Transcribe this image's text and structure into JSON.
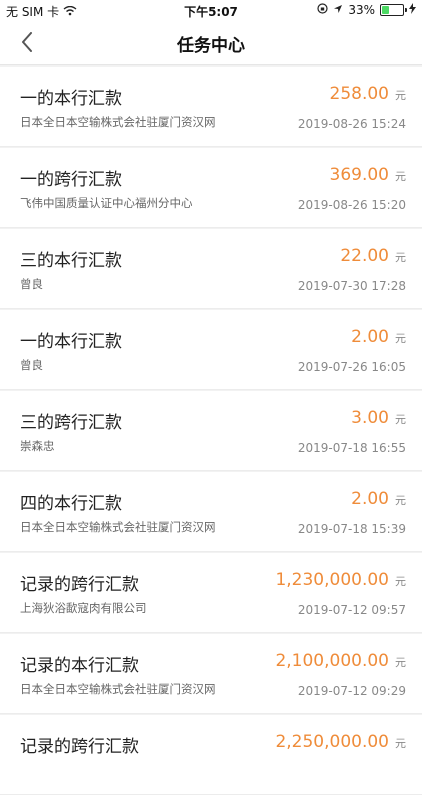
{
  "status_bar": {
    "carrier": "无 SIM 卡",
    "time": "下午5:07",
    "battery_percent": "33%",
    "battery_level": 0.33
  },
  "nav": {
    "title": "任务中心"
  },
  "tasks": [
    {
      "title": "一的本行汇款",
      "subtitle": "日本全日本空输株式会社驻厦门资汉网",
      "amount": "258.00",
      "unit": "元",
      "time": "2019-08-26 15:24"
    },
    {
      "title": "一的跨行汇款",
      "subtitle": "飞伟中国质量认证中心福州分中心",
      "amount": "369.00",
      "unit": "元",
      "time": "2019-08-26 15:20"
    },
    {
      "title": "三的本行汇款",
      "subtitle": "曾良",
      "amount": "22.00",
      "unit": "元",
      "time": "2019-07-30 17:28"
    },
    {
      "title": "一的本行汇款",
      "subtitle": "曾良",
      "amount": "2.00",
      "unit": "元",
      "time": "2019-07-26 16:05"
    },
    {
      "title": "三的跨行汇款",
      "subtitle": "崇森忠",
      "amount": "3.00",
      "unit": "元",
      "time": "2019-07-18 16:55"
    },
    {
      "title": "四的本行汇款",
      "subtitle": "日本全日本空输株式会社驻厦门资汉网",
      "amount": "2.00",
      "unit": "元",
      "time": "2019-07-18 15:39"
    },
    {
      "title": "记录的跨行汇款",
      "subtitle": "上海狄浴歃寇肉有限公司",
      "amount": "1,230,000.00",
      "unit": "元",
      "time": "2019-07-12 09:57"
    },
    {
      "title": "记录的本行汇款",
      "subtitle": "日本全日本空输株式会社驻厦门资汉网",
      "amount": "2,100,000.00",
      "unit": "元",
      "time": "2019-07-12 09:29"
    },
    {
      "title": "记录的跨行汇款",
      "subtitle": "",
      "amount": "2,250,000.00",
      "unit": "元",
      "time": ""
    }
  ]
}
